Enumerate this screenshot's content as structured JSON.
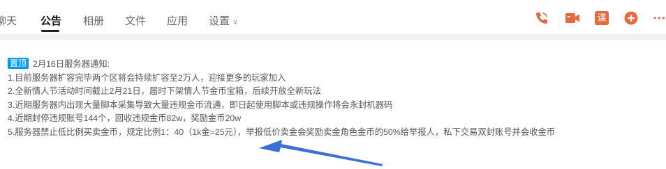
{
  "tabs": [
    {
      "label": "聊天"
    },
    {
      "label": "公告"
    },
    {
      "label": "相册"
    },
    {
      "label": "文件"
    },
    {
      "label": "应用"
    },
    {
      "label": "设置"
    }
  ],
  "toolbar": {
    "icons": [
      "phone-icon",
      "video-icon",
      "course-icon",
      "add-icon",
      "more-icon"
    ],
    "course_glyph": "课",
    "more_glyph": "•••",
    "chevron_glyph": "∨"
  },
  "announcement": {
    "tag": "置顶",
    "title": "2月16日服务器通知:",
    "lines": [
      "1.目前服务器扩容完毕两个区将会持续扩容至2万人，迎接更多的玩家加入",
      "2.全新情人节活动时间截止2月21日，届时下架情人节金币宝箱，后续开放全新玩法",
      "3.近期服务器内出现大量脚本采集导致大量违规金币流通，即日起使用脚本或违规操作将会永封机器码",
      "4.近期封停违规账号144个，回收违规金币82w，奖励金币20w",
      "5.服务器禁止低比例买卖金币，规定比例1：40（1k金=25元），举报低价卖金会奖励卖金角色金币的50%给举报人，私下交易双封账号并会收金币"
    ]
  },
  "colors": {
    "accent_blue": "#0099ff",
    "icon_orange": "#e8683f",
    "arrow_blue": "#3b6fd6"
  }
}
